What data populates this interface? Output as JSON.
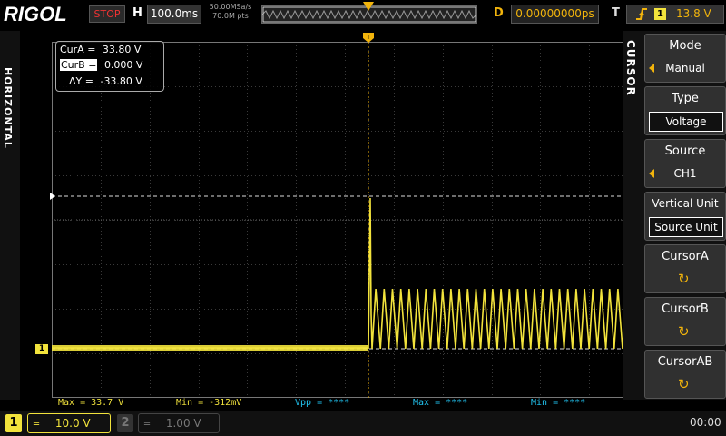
{
  "brand": "RIGOL",
  "status": "STOP",
  "horizontal": {
    "label": "H",
    "timebase": "100.0ms",
    "sample_rate": "50.00MSa/s",
    "memory": "70.0M pts"
  },
  "delay": {
    "label": "D",
    "value": "0.00000000ps"
  },
  "trigger": {
    "label": "T",
    "channel": "1",
    "level": "13.8 V",
    "slope_icon": "rising-edge-icon"
  },
  "side_label": "HORIZONTAL",
  "menu": {
    "title": "CURSOR",
    "items": [
      {
        "title": "Mode",
        "value": "Manual"
      },
      {
        "title": "Type",
        "value": "Voltage"
      },
      {
        "title": "Source",
        "value": "CH1"
      },
      {
        "title": "Vertical Unit",
        "value": "Source Unit"
      },
      {
        "title": "CursorA",
        "icon": "knob-icon"
      },
      {
        "title": "CursorB",
        "icon": "knob-icon"
      },
      {
        "title": "CursorAB",
        "icon": "knob-icon"
      }
    ]
  },
  "cursor_readout": {
    "cur_a_label": "CurA =",
    "cur_a": "33.80 V",
    "cur_b_label": "CurB =",
    "cur_b": "0.000 V",
    "delta_label": "ΔY =",
    "delta": "-33.80 V"
  },
  "measurements": [
    {
      "text": "Max = 33.7 V",
      "color": "#f2e33c"
    },
    {
      "text": "Min = -312mV",
      "color": "#f2e33c"
    },
    {
      "text": "Vpp = ****",
      "color": "#21c5f2"
    },
    {
      "text": "Max = ****",
      "color": "#21c5f2"
    },
    {
      "text": "Min = ****",
      "color": "#21c5f2"
    }
  ],
  "channels": [
    {
      "num": "1",
      "scale": "10.0 V",
      "active": true
    },
    {
      "num": "2",
      "scale": "1.00 V",
      "active": false
    }
  ],
  "clock": "00:00",
  "ch1_marker": "1",
  "colors": {
    "ch1": "#f2e33c",
    "trigger": "#f2b40c",
    "ch2": "#21c5f2"
  }
}
